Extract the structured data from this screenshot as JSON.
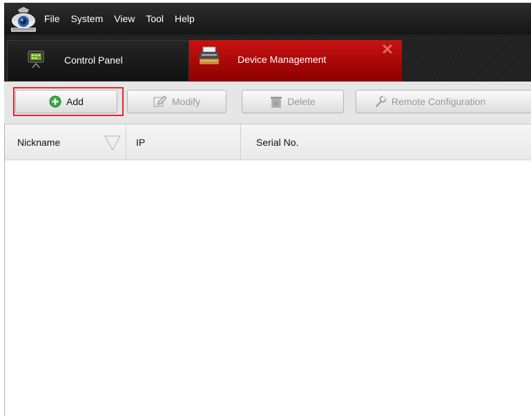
{
  "menubar": {
    "logo_icon": "camera-logo-icon",
    "items": [
      {
        "label": "File"
      },
      {
        "label": "System"
      },
      {
        "label": "View"
      },
      {
        "label": "Tool"
      },
      {
        "label": "Help"
      }
    ]
  },
  "tabs": [
    {
      "label": "Control Panel",
      "icon": "control-panel-icon",
      "active": false
    },
    {
      "label": "Device Management",
      "icon": "device-management-icon",
      "active": true,
      "closable": true
    }
  ],
  "toolbar": {
    "add_label": "Add",
    "modify_label": "Modify",
    "delete_label": "Delete",
    "remote_config_label": "Remote Configuration",
    "add_highlight_color": "#e8232b"
  },
  "table": {
    "columns": [
      {
        "label": "Nickname"
      },
      {
        "label": "IP"
      },
      {
        "label": "Serial No."
      }
    ],
    "rows": []
  },
  "colors": {
    "active_tab": "#c10f0f",
    "menubar": "#1e1e1e",
    "add_icon": "#3aa64a"
  }
}
